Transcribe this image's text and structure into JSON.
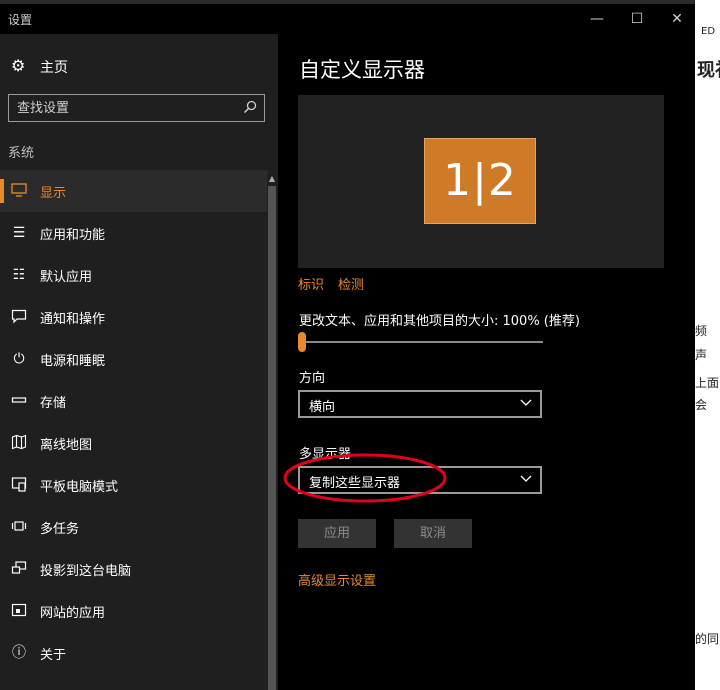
{
  "background": {
    "fragments": [
      "现礼",
      "ED",
      "频",
      "声",
      "上面",
      "会",
      "的同"
    ]
  },
  "window": {
    "title": "设置",
    "controls": {
      "minimize": "—",
      "maximize": "☐",
      "close": "✕"
    }
  },
  "sidebar": {
    "home_label": "主页",
    "search_placeholder": "查找设置",
    "section_label": "系统",
    "items": [
      {
        "label": "显示",
        "icon": "monitor-icon",
        "active": true
      },
      {
        "label": "应用和功能",
        "icon": "apps-list-icon"
      },
      {
        "label": "默认应用",
        "icon": "default-apps-icon"
      },
      {
        "label": "通知和操作",
        "icon": "notification-icon"
      },
      {
        "label": "电源和睡眠",
        "icon": "power-icon"
      },
      {
        "label": "存储",
        "icon": "storage-icon"
      },
      {
        "label": "离线地图",
        "icon": "map-icon"
      },
      {
        "label": "平板电脑模式",
        "icon": "tablet-mode-icon"
      },
      {
        "label": "多任务",
        "icon": "multitask-icon"
      },
      {
        "label": "投影到这台电脑",
        "icon": "project-icon"
      },
      {
        "label": "网站的应用",
        "icon": "web-apps-icon"
      },
      {
        "label": "关于",
        "icon": "info-icon"
      }
    ]
  },
  "main": {
    "title": "自定义显示器",
    "monitor_label": "1|2",
    "identify_link": "标识",
    "detect_link": "检测",
    "scale_label": "更改文本、应用和其他项目的大小: 100% (推荐)",
    "scale_slider_fraction": 0.0,
    "orientation_label": "方向",
    "orientation_value": "横向",
    "multi_display_label": "多显示器",
    "multi_display_value": "复制这些显示器",
    "apply_button": "应用",
    "cancel_button": "取消",
    "advanced_link": "高级显示设置"
  },
  "colors": {
    "accent": "#e8892e",
    "monitor_fill": "#ce7a26",
    "annotation": "#e0001b"
  }
}
